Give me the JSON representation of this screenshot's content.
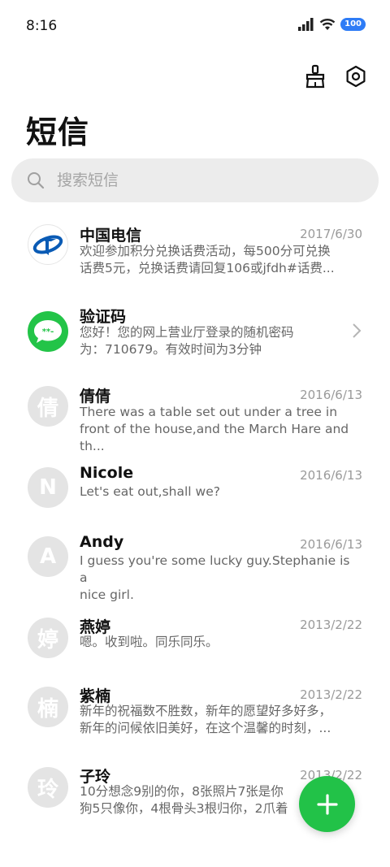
{
  "status": {
    "time": "8:16",
    "battery": "100"
  },
  "header": {
    "title": "短信"
  },
  "search": {
    "placeholder": "搜索短信"
  },
  "conversations": [
    {
      "name": "中国电信",
      "date": "2017/6/30",
      "line1": "欢迎参加积分兑换话费活动，每500分可兑换",
      "line2": "话费5元，兑换话费请回复106或jfdh#话费...",
      "avatar": ""
    },
    {
      "name": "验证码",
      "date": "",
      "line1": "您好！您的网上营业厅登录的随机密码",
      "line2": "为：710679。有效时间为3分钟",
      "avatar": "**-"
    },
    {
      "name": "倩倩",
      "date": "2016/6/13",
      "line1": "There was a table set out under a tree in",
      "line2": "front of the house,and the March Hare and th...",
      "avatar": "倩"
    },
    {
      "name": "Nicole",
      "date": "2016/6/13",
      "line1": "Let's eat out,shall we?",
      "line2": "",
      "avatar": "N"
    },
    {
      "name": "Andy",
      "date": "2016/6/13",
      "line1": "I guess you're some lucky guy.Stephanie is a",
      "line2": "nice girl.",
      "avatar": "A"
    },
    {
      "name": "燕婷",
      "date": "2013/2/22",
      "line1": "嗯。收到啦。同乐同乐。",
      "line2": "",
      "avatar": "婷"
    },
    {
      "name": "紫楠",
      "date": "2013/2/22",
      "line1": "新年的祝福数不胜数，新年的愿望好多好多，",
      "line2": "新年的问候依旧美好，在这个温馨的时刻，...",
      "avatar": "楠"
    },
    {
      "name": "子玲",
      "date": "2013/2/22",
      "line1": "10分想念9别的你，8张照片7张是你",
      "line2": "狗5只像你，4根骨头3根归你，2爪着",
      "avatar": "玲"
    }
  ],
  "fab": {
    "label": "+"
  },
  "colors": {
    "accent": "#22c248",
    "telecom_blue": "#0a5bb5",
    "battery": "#2e7cf6"
  }
}
